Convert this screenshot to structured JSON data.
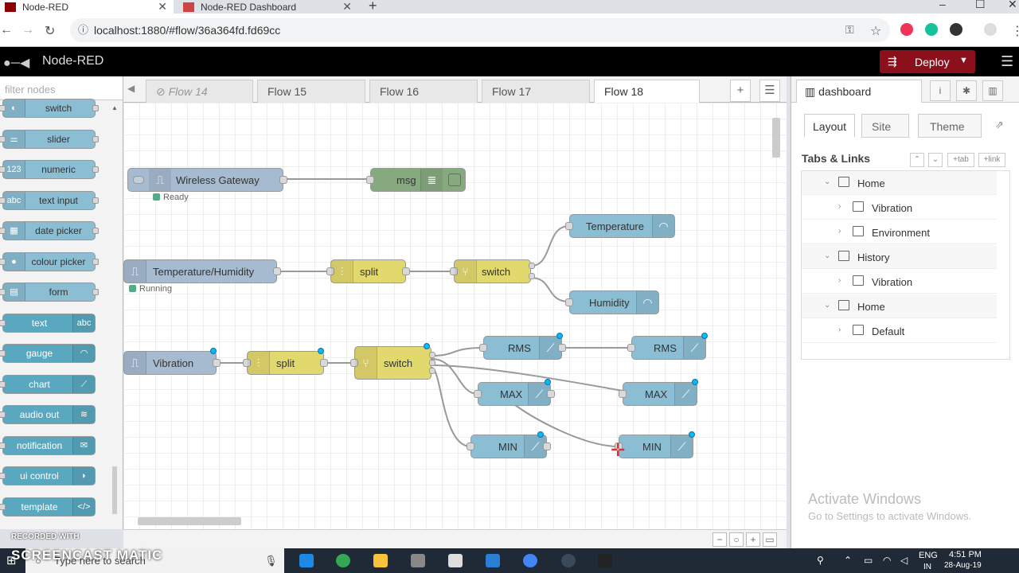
{
  "browser": {
    "tabs": [
      {
        "title": "Node-RED",
        "active": true
      },
      {
        "title": "Node-RED Dashboard",
        "active": false
      }
    ],
    "url": "localhost:1880/#flow/36a364fd.fd69cc"
  },
  "header": {
    "title": "Node-RED",
    "deploy_label": "Deploy"
  },
  "palette": {
    "search_placeholder": "filter nodes",
    "nodes": [
      {
        "label": "switch",
        "icon": "toggle-icon"
      },
      {
        "label": "slider",
        "icon": "slider-icon"
      },
      {
        "label": "numeric",
        "icon": "numeric-icon",
        "glyph": "123"
      },
      {
        "label": "text input",
        "icon": "text-input-icon",
        "glyph": "abc"
      },
      {
        "label": "date picker",
        "icon": "calendar-icon"
      },
      {
        "label": "colour picker",
        "icon": "palette-icon"
      },
      {
        "label": "form",
        "icon": "form-icon"
      },
      {
        "label": "text",
        "icon": "text-icon",
        "glyph": "abc"
      },
      {
        "label": "gauge",
        "icon": "gauge-icon"
      },
      {
        "label": "chart",
        "icon": "chart-icon"
      },
      {
        "label": "audio out",
        "icon": "audio-icon"
      },
      {
        "label": "notification",
        "icon": "envelope-icon"
      },
      {
        "label": "ui control",
        "icon": "control-icon"
      },
      {
        "label": "template",
        "icon": "code-icon",
        "glyph": "</>"
      }
    ]
  },
  "workspace": {
    "tabs": [
      "Flow 14",
      "Flow 15",
      "Flow 16",
      "Flow 17",
      "Flow 18"
    ],
    "active_tab": "Flow 18",
    "nodes": {
      "wireless_gateway": "Wireless Gateway",
      "wireless_status": "Ready",
      "msg": "msg",
      "temp_humidity": "Temperature/Humidity",
      "temp_humidity_status": "Running",
      "split1": "split",
      "switch1": "switch",
      "temperature": "Temperature",
      "humidity": "Humidity",
      "vibration": "Vibration",
      "split2": "split",
      "switch2": "switch",
      "rms1": "RMS",
      "rms2": "RMS",
      "max1": "MAX",
      "max2": "MAX",
      "min1": "MIN",
      "min2": "MIN"
    }
  },
  "sidebar": {
    "tab_label": "dashboard",
    "subtabs": [
      "Layout",
      "Site",
      "Theme"
    ],
    "tabs_links_title": "Tabs & Links",
    "buttons": {
      "tab": "tab",
      "link": "link"
    },
    "tree": [
      {
        "label": "Home",
        "level": 0
      },
      {
        "label": "Vibration",
        "level": 1
      },
      {
        "label": "Environment",
        "level": 1
      },
      {
        "label": "History",
        "level": 0
      },
      {
        "label": "Vibration",
        "level": 1
      },
      {
        "label": "Home",
        "level": 0
      },
      {
        "label": "Default",
        "level": 1
      }
    ]
  },
  "watermark": {
    "line1": "Activate Windows",
    "line2": "Go to Settings to activate Windows."
  },
  "overlay": {
    "recorded": "RECORDED WITH",
    "brand": "SCREENCAST MATIC"
  },
  "taskbar": {
    "search_placeholder": "Type here to search",
    "lang1": "ENG",
    "lang2": "IN",
    "time": "4:51 PM",
    "date": "28-Aug-19"
  },
  "colors": {
    "header_bg": "#000000",
    "deploy_bg": "#8c101c",
    "dashboard_node": "#8bbdd3",
    "function_node": "#e2d96e",
    "input_node": "#a6bbcf",
    "debug_node": "#87a980",
    "changed_dot": "#00bcff"
  }
}
